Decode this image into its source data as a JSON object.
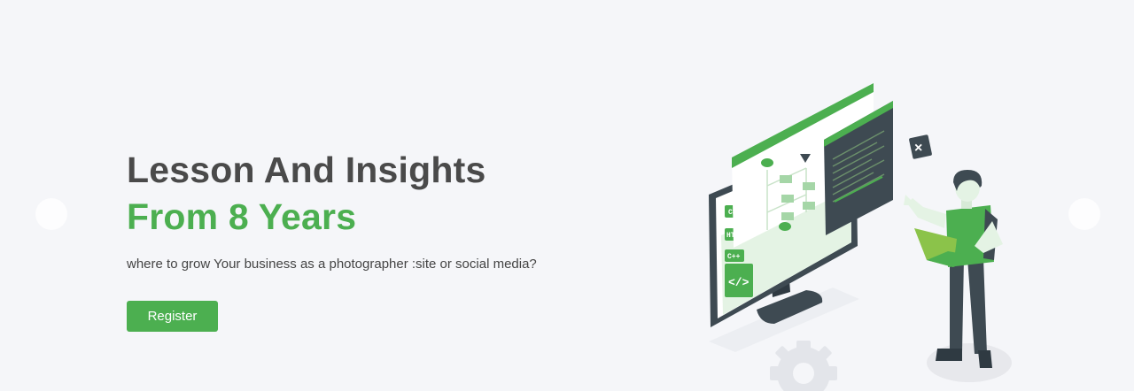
{
  "hero": {
    "headline_line1": "Lesson And Insights",
    "headline_line2": "From 8 Years",
    "subtitle": "where to grow Your business as a photographer :site or social media?",
    "register_label": "Register"
  },
  "illustration": {
    "code_tags": [
      "CSS",
      "HTML",
      "C++"
    ],
    "code_icon": "</>",
    "close_icon": "×"
  },
  "colors": {
    "accent": "#4caf50",
    "heading": "#4a4a4a",
    "background": "#f5f6f9",
    "dark_slate": "#3e4a52"
  }
}
